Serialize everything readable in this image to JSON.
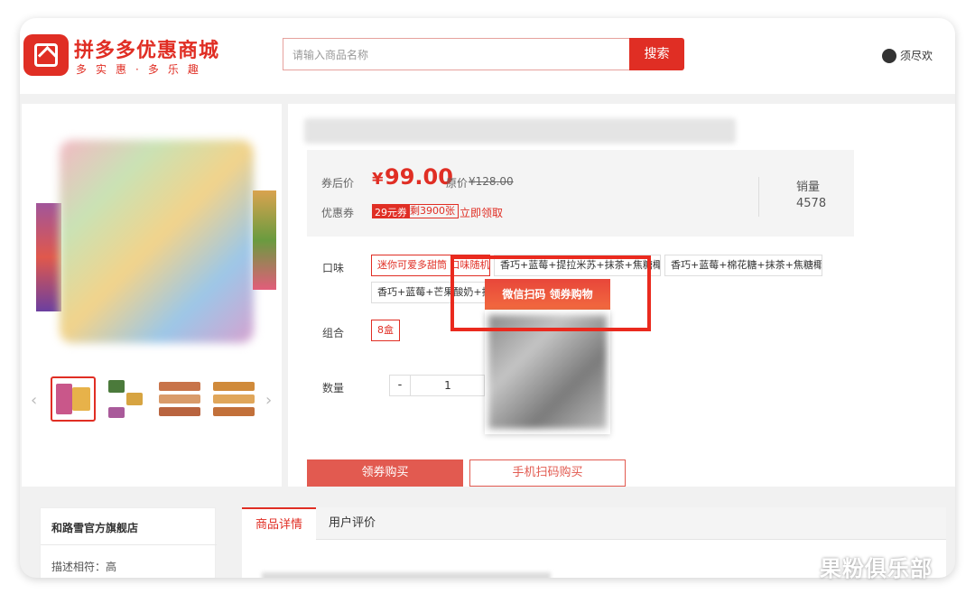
{
  "header": {
    "brand_title": "拼多多优惠商城",
    "slogan": "多实惠·多乐趣",
    "search_placeholder": "请输入商品名称",
    "search_button": "搜索",
    "username": "须尽欢"
  },
  "product": {
    "price_label": "券后价",
    "currency": "¥",
    "price": "99.00",
    "original_label": "原价",
    "original_price": "¥128.00",
    "coupon_label": "优惠券",
    "coupon_amount": "29元券",
    "coupon_remaining": "剩3900张",
    "coupon_claim": "立即领取",
    "sales_label": "销量",
    "sales_value": "4578"
  },
  "options": {
    "flavor_label": "口味",
    "flavors": [
      "迷你可爱多甜筒 口味随机",
      "香巧+蓝莓+提拉米苏+抹茶+焦糖椰子",
      "香巧+蓝莓+棉花糖+抹茶+焦糖椰子",
      "香巧+蓝莓+芒果酸奶+抹茶"
    ],
    "combo_label": "组合",
    "combos": [
      "8盒"
    ],
    "qty_label": "数量",
    "qty_minus": "-",
    "qty_value": "1",
    "qty_plus": "+"
  },
  "actions": {
    "buy_button": "领券购买",
    "scan_buy_button": "手机扫码购买"
  },
  "popup": {
    "title": "微信扫码 领券购物"
  },
  "store": {
    "name": "和路雪官方旗舰店",
    "rating": "描述相符：高"
  },
  "tabs": [
    {
      "label": "商品详情",
      "active": true
    },
    {
      "label": "用户评价",
      "active": false
    }
  ],
  "watermark": "果粉俱乐部",
  "colors": {
    "brand_red": "#e02e24",
    "highlight_red": "#ea2a1e"
  }
}
